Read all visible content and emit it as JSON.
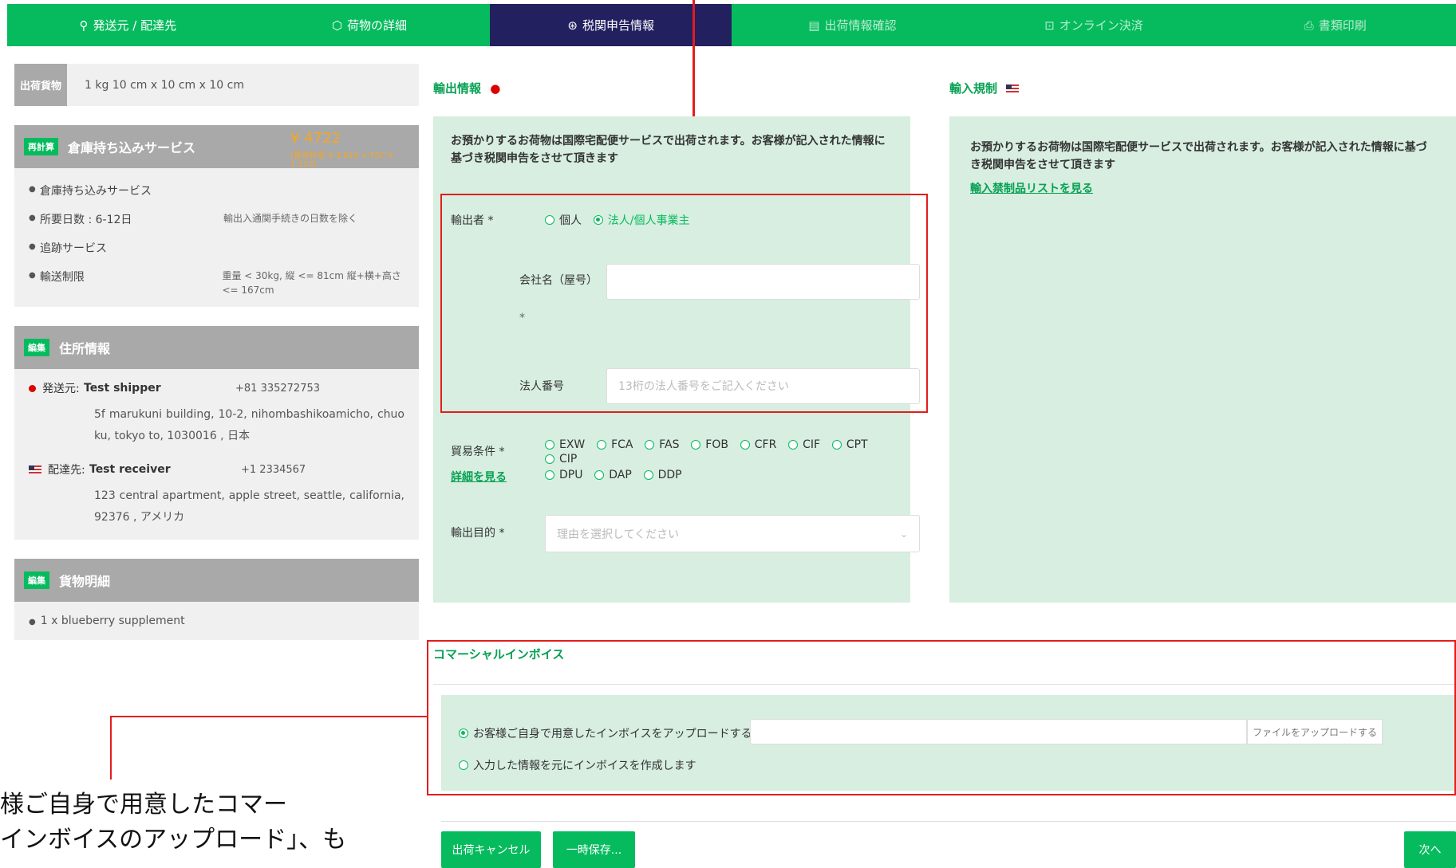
{
  "steps": [
    {
      "icon": "⚲",
      "label": "発送元 / 配達先"
    },
    {
      "icon": "⬡",
      "label": "荷物の詳細"
    },
    {
      "icon": "⊛",
      "label": "税関申告情報"
    },
    {
      "icon": "▤",
      "label": "出荷情報確認"
    },
    {
      "icon": "⊡",
      "label": "オンライン決済"
    },
    {
      "icon": "⎙",
      "label": "書類印刷"
    }
  ],
  "colors": {
    "brand_green": "#06bb5e",
    "active_step": "#232060",
    "annotation_red": "#e31d1d",
    "price_orange": "#f5a623"
  },
  "cargo": {
    "tag": "出荷貨物",
    "summary": "1 kg 10 cm x 10 cm x 10 cm"
  },
  "service": {
    "badge": "再計算",
    "title": "倉庫持ち込みサービス",
    "price": "¥ 4722",
    "price_breakdown": "(基本料金 ¥ 3,610 + FSC ¥ 1,112)",
    "items": [
      {
        "label": "倉庫持ち込みサービス",
        "note": ""
      },
      {
        "label": "所要日数 : 6-12日",
        "note": "輸出入通関手続きの日数を除く"
      },
      {
        "label": "追跡サービス",
        "note": ""
      },
      {
        "label": "輸送制限",
        "note": "重量 < 30kg, 縦 <= 81cm 縦+横+高さ <= 167cm"
      }
    ]
  },
  "address": {
    "badge": "編集",
    "title": "住所情報",
    "shipper_label": "発送元:",
    "shipper_name": "Test shipper",
    "shipper_phone": "+81 335272753",
    "shipper_address": "5f marukuni building, 10-2, nihombashikoamicho, chuo ku, tokyo to, 1030016 , 日本",
    "receiver_label": "配達先:",
    "receiver_name": "Test receiver",
    "receiver_phone": "+1 2334567",
    "receiver_address": "123 central apartment, apple street, seattle, california, 92376 , アメリカ"
  },
  "goods": {
    "badge": "編集",
    "title": "貨物明細",
    "items": [
      "1 x blueberry supplement"
    ]
  },
  "export": {
    "title": "輸出情報",
    "desc": "お預かりするお荷物は国際宅配便サービスで出荷されます。お客様が記入された情報に基づき税関申告をさせて頂きます",
    "exporter_label": "輸出者 *",
    "exporter_options": [
      "個人",
      "法人/個人事業主"
    ],
    "company_label": "会社名（屋号）",
    "company_required": "*",
    "corp_number_label": "法人番号",
    "corp_number_placeholder": "13桁の法人番号をご記入ください",
    "trade_label": "貿易条件 *",
    "trade_link": "詳細を見る",
    "trade_terms_row1": [
      "EXW",
      "FCA",
      "FAS",
      "FOB",
      "CFR",
      "CIF",
      "CPT",
      "CIP"
    ],
    "trade_terms_row2": [
      "DPU",
      "DAP",
      "DDP"
    ],
    "purpose_label": "輸出目的 *",
    "purpose_placeholder": "理由を選択してください"
  },
  "import": {
    "title": "輸入規制",
    "desc": "お預かりするお荷物は国際宅配便サービスで出荷されます。お客様が記入された情報に基づき税関申告をさせて頂きます",
    "link": "輸入禁制品リストを見る"
  },
  "invoice": {
    "title": "コマーシャルインボイス",
    "option_upload": "お客様ご自身で用意したインボイスをアップロードする",
    "option_create": "入力した情報を元にインボイスを作成します",
    "upload_button": "ファイルをアップロードする"
  },
  "buttons": {
    "cancel": "出荷キャンセル",
    "save": "一時保存...",
    "next": "次へ"
  },
  "caption": {
    "line1": "様ご自身で用意したコマー",
    "line2": "インボイスのアップロード」、も"
  }
}
